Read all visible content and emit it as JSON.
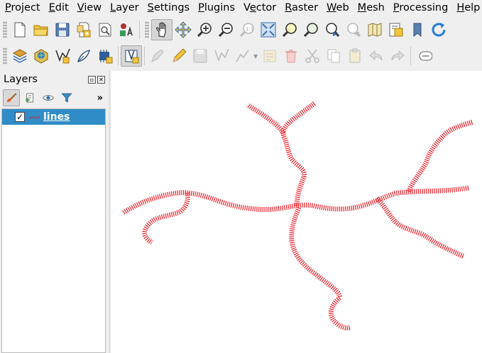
{
  "menu": [
    {
      "label": "Project",
      "accel_index": 0
    },
    {
      "label": "Edit",
      "accel_index": 0
    },
    {
      "label": "View",
      "accel_index": 0
    },
    {
      "label": "Layer",
      "accel_index": 0
    },
    {
      "label": "Settings",
      "accel_index": 0
    },
    {
      "label": "Plugins",
      "accel_index": 0
    },
    {
      "label": "Vector",
      "accel_index": 1
    },
    {
      "label": "Raster",
      "accel_index": 0
    },
    {
      "label": "Web",
      "accel_index": 0
    },
    {
      "label": "Mesh",
      "accel_index": 0
    },
    {
      "label": "Processing",
      "accel_index": 0
    },
    {
      "label": "Help",
      "accel_index": 0
    }
  ],
  "toolbar_project": [
    "new-project-icon",
    "open-project-icon",
    "save-project-icon",
    "new-print-layout-icon",
    "style-manager-icon",
    "python-console-icon"
  ],
  "toolbar_navigation": [
    "pan-map-icon",
    "pan-to-selection-icon",
    "zoom-in-icon",
    "zoom-out-icon",
    "zoom-native-icon",
    "zoom-full-icon",
    "zoom-to-selection-icon",
    "zoom-to-layer-icon",
    "zoom-last-icon",
    "zoom-next-icon",
    "new-map-view-icon",
    "temporal-controller-icon",
    "refresh-icon"
  ],
  "toolbar_data": [
    "data-source-manager-icon",
    "new-geopackage-icon",
    "new-virtual-layer-icon",
    "digitize-icon",
    "mesh-layer-icon",
    "spatial-bookmark-icon"
  ],
  "toolbar_edit": [
    "current-edits-icon",
    "toggle-editing-icon",
    "save-edits-icon",
    "digitize-vertex-icon",
    "modify-attributes-icon",
    "node-tool-icon",
    "delete-selected-icon",
    "cut-features-icon",
    "copy-features-icon",
    "paste-features-icon",
    "undo-icon",
    "redo-icon",
    "label-tool-icon"
  ],
  "layers_panel": {
    "title": "Layers",
    "layers": [
      {
        "name": "lines",
        "visible": true,
        "geometry": "line",
        "selected": true
      }
    ]
  },
  "colors": {
    "line_stroke": "#e8202a",
    "selection": "#308cc6"
  }
}
